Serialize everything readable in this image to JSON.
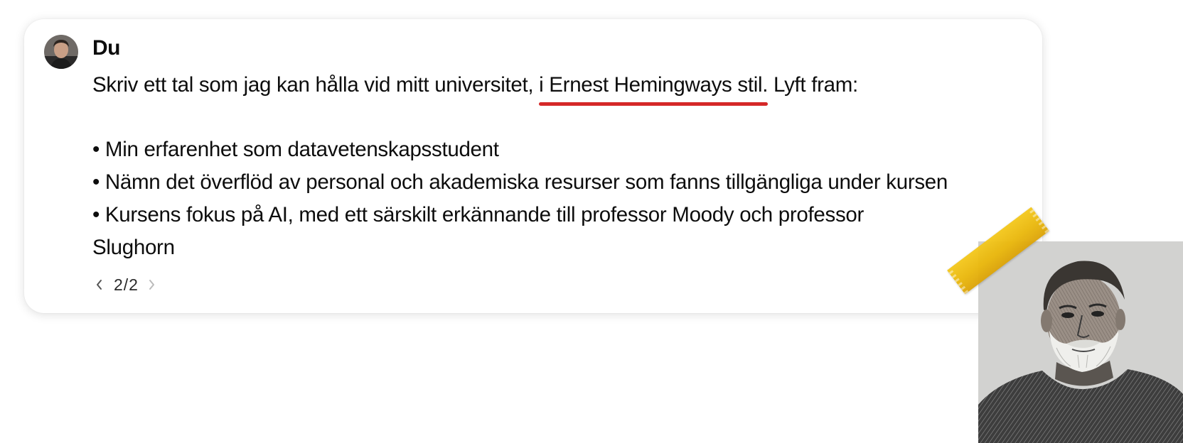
{
  "message": {
    "author": "Du",
    "line1_before": "Skriv ett tal som jag kan hålla vid mitt universitet, ",
    "line1_highlight": "i Ernest Hemingways stil.",
    "line1_after": " Lyft fram:",
    "bullets": [
      "• Min erfarenhet som datavetenskapsstudent",
      "• Nämn det överflöd av personal och akademiska resurser som fanns tillgängliga under kursen",
      "• Kursens fokus på AI, med ett särskilt erkännande till professor Moody och professor"
    ],
    "bullet_continuation": "Slughorn",
    "highlight_color": "#d52828"
  },
  "pager": {
    "current": "2/2",
    "prev_icon": "chevron-left-icon",
    "next_icon": "chevron-right-icon"
  },
  "decorations": {
    "avatar_icon": "user-avatar",
    "portrait_icon": "bearded-man-sketch",
    "tape_color": "#f2c41a"
  }
}
